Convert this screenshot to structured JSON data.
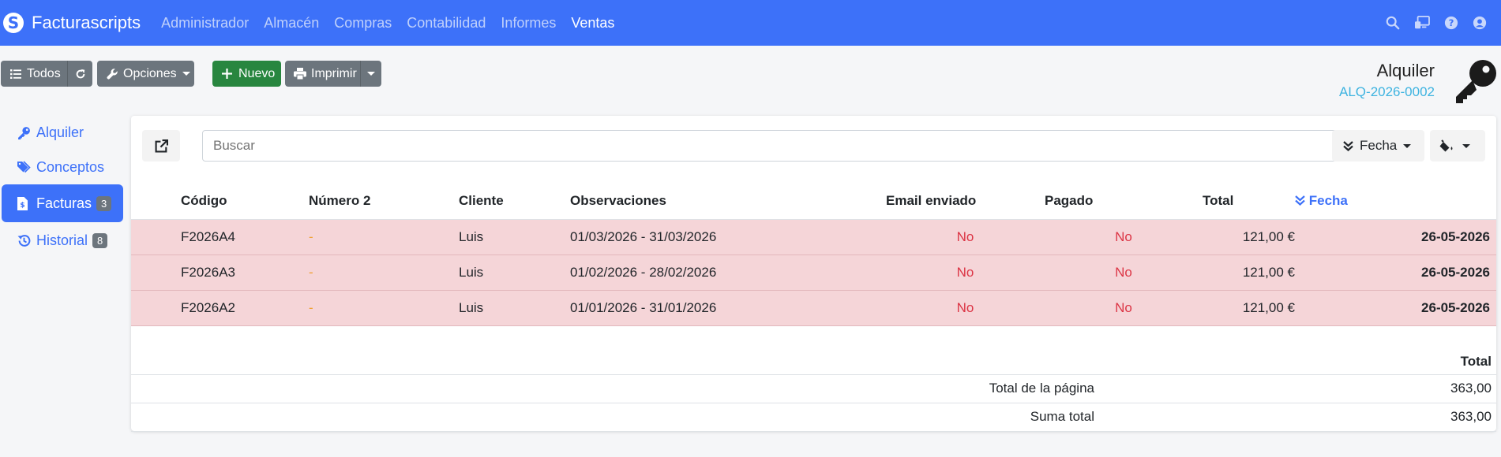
{
  "navbar": {
    "brand": "Facturascripts",
    "menu": [
      "Administrador",
      "Almacén",
      "Compras",
      "Contabilidad",
      "Informes",
      "Ventas"
    ],
    "active": "Ventas",
    "icons": [
      "search-icon",
      "screen-icon",
      "help-icon",
      "user-icon"
    ]
  },
  "toolbar": {
    "all_label": "Todos",
    "options_label": "Opciones",
    "new_label": "Nuevo",
    "print_label": "Imprimir"
  },
  "header": {
    "title": "Alquiler",
    "code": "ALQ-2026-0002"
  },
  "sidebar": {
    "items": [
      {
        "label": "Alquiler",
        "icon": "key-icon",
        "badge": null
      },
      {
        "label": "Conceptos",
        "icon": "tags-icon",
        "badge": null
      },
      {
        "label": "Facturas",
        "icon": "file-invoice-icon",
        "badge": "3"
      },
      {
        "label": "Historial",
        "icon": "history-icon",
        "badge": "8"
      }
    ],
    "active": "Facturas"
  },
  "search": {
    "placeholder": "Buscar",
    "order_label": "Fecha"
  },
  "table": {
    "columns": [
      "Código",
      "Número 2",
      "Cliente",
      "Observaciones",
      "Email enviado",
      "Pagado",
      "Total",
      "Fecha"
    ],
    "rows": [
      {
        "code": "F2026A4",
        "num2": "-",
        "client": "Luis",
        "obs": "01/03/2026 - 31/03/2026",
        "email": "No",
        "paid": "No",
        "total": "121,00 €",
        "date": "26-05-2026"
      },
      {
        "code": "F2026A3",
        "num2": "-",
        "client": "Luis",
        "obs": "01/02/2026 - 28/02/2026",
        "email": "No",
        "paid": "No",
        "total": "121,00 €",
        "date": "26-05-2026"
      },
      {
        "code": "F2026A2",
        "num2": "-",
        "client": "Luis",
        "obs": "01/01/2026 - 31/01/2026",
        "email": "No",
        "paid": "No",
        "total": "121,00 €",
        "date": "26-05-2026"
      }
    ]
  },
  "totals": {
    "header": "Total",
    "page_label": "Total de la página",
    "page_value": "363,00",
    "sum_label": "Suma total",
    "sum_value": "363,00"
  },
  "colors": {
    "primary": "#3d71f9",
    "row_bg": "#f5d5d8",
    "danger": "#dc3545",
    "success": "#28863f",
    "secondary": "#6c757d"
  }
}
